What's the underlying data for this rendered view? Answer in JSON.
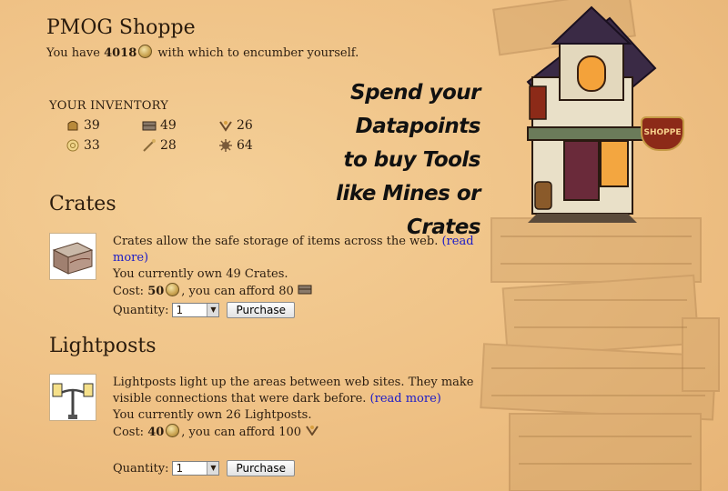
{
  "header": {
    "title": "PMOG Shoppe",
    "balance_prefix": "You have",
    "balance": "4018",
    "balance_suffix": "with which to encumber yourself."
  },
  "inventory": {
    "heading": "YOUR INVENTORY",
    "items": [
      {
        "icon": "armor-icon",
        "count": "39"
      },
      {
        "icon": "crate-icon",
        "count": "49"
      },
      {
        "icon": "lightpost-icon",
        "count": "26"
      },
      {
        "icon": "portal-icon",
        "count": "33"
      },
      {
        "icon": "st-nick-icon",
        "count": "28"
      },
      {
        "icon": "mine-icon",
        "count": "64"
      }
    ]
  },
  "promo": {
    "line1": "Spend your Datapoints",
    "line2": "to buy Tools",
    "line3": "like Mines or Crates"
  },
  "sign": "SHOPPE",
  "crates": {
    "title": "Crates",
    "desc": "Crates allow the safe storage of items across the web.",
    "read_more": "(read more)",
    "own": "You currently own 49 Crates.",
    "cost_label": "Cost:",
    "cost": "50",
    "afford": ", you can afford 80",
    "qty_label": "Quantity:",
    "qty_value": "1",
    "purchase": "Purchase"
  },
  "lightposts": {
    "title": "Lightposts",
    "desc": "Lightposts light up the areas between web sites. They make visible connections that were dark before.",
    "read_more": "(read more)",
    "own": "You currently own 26 Lightposts.",
    "cost_label": "Cost:",
    "cost": "40",
    "afford": ", you can afford 100",
    "qty_label": "Quantity:",
    "qty_value": "1",
    "purchase": "Purchase"
  },
  "colors": {
    "background": "#efc185",
    "link": "#1b1bc8",
    "sign": "#8c2a18"
  }
}
